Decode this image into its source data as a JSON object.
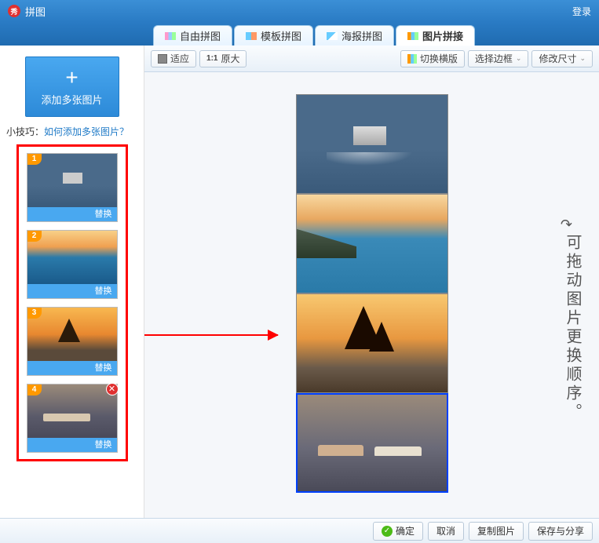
{
  "titlebar": {
    "app_icon": "秀",
    "title": "拼图",
    "login": "登录"
  },
  "tabs": [
    {
      "label": "自由拼图"
    },
    {
      "label": "模板拼图"
    },
    {
      "label": "海报拼图"
    },
    {
      "label": "图片拼接"
    }
  ],
  "active_tab": 3,
  "sidebar": {
    "add_label": "添加多张图片",
    "tip_prefix": "小技巧：",
    "tip_link": "如何添加多张图片？",
    "replace_label": "替换",
    "thumbs": [
      {
        "num": "1"
      },
      {
        "num": "2"
      },
      {
        "num": "3"
      },
      {
        "num": "4",
        "closable": true
      }
    ]
  },
  "toolbar": {
    "fit": "适应",
    "original": "原大",
    "switch_template": "切换横版",
    "select_border": "选择边框",
    "modify_size": "修改尺寸"
  },
  "canvas": {
    "hint": "可拖动图片更换顺序。"
  },
  "footer": {
    "ok": "确定",
    "cancel": "取消",
    "copy": "复制图片",
    "save": "保存与分享"
  }
}
